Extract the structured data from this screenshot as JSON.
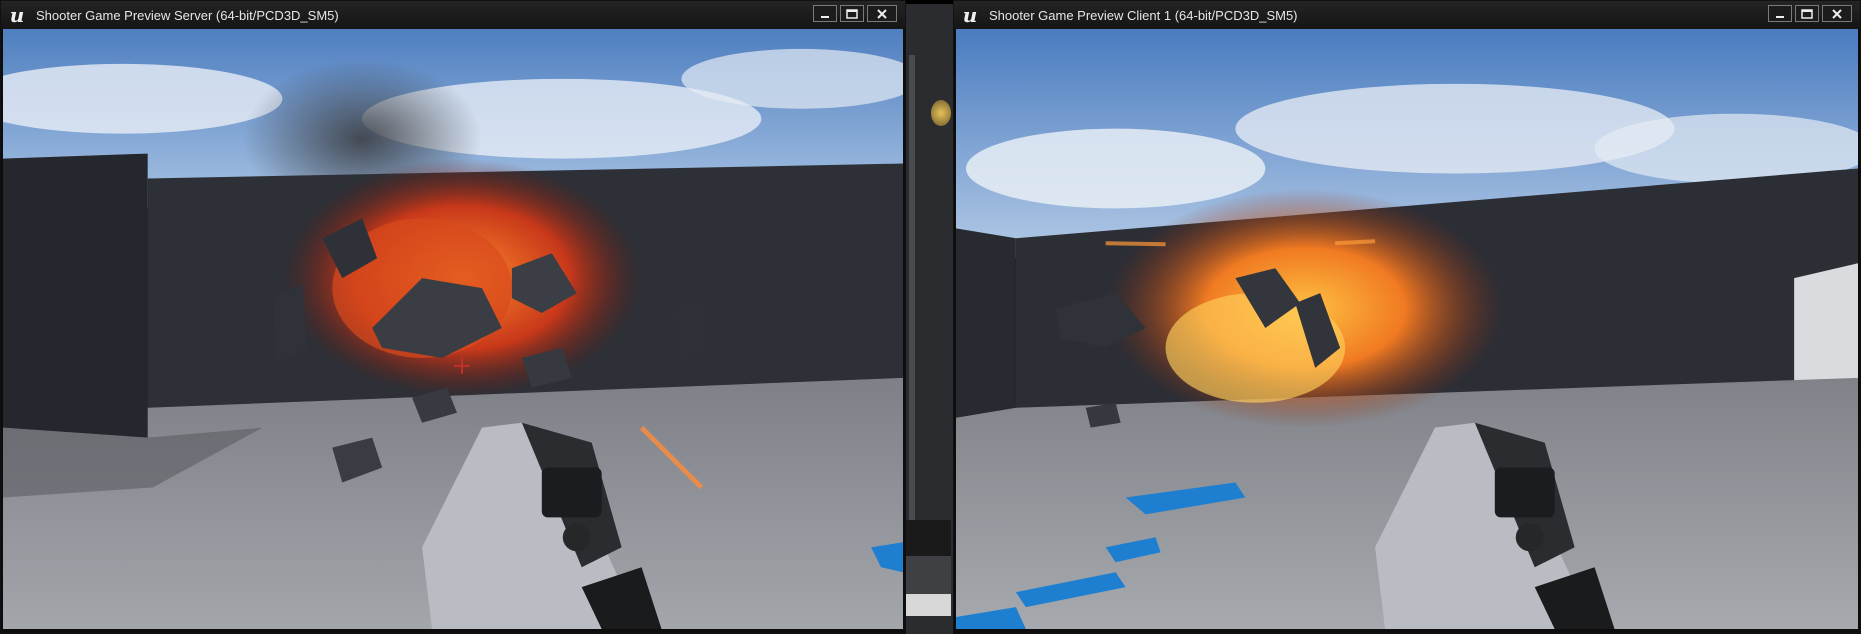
{
  "windows": {
    "server": {
      "title": "Shooter Game Preview Server (64-bit/PCD3D_SM5)",
      "logo": "ue-logo-icon",
      "controls": {
        "minimize": "minimize-icon",
        "maximize": "maximize-icon",
        "close": "close-icon"
      }
    },
    "client": {
      "title": "Shooter Game Preview Client 1 (64-bit/PCD3D_SM5)",
      "logo": "ue-logo-icon",
      "controls": {
        "minimize": "minimize-icon",
        "maximize": "maximize-icon",
        "close": "close-icon"
      }
    }
  },
  "colors": {
    "sky": "#7fa6d6",
    "wall": "#2b2e35",
    "floor": "#8d9096",
    "fire": "#e2521c",
    "fire_core": "#ffb433",
    "floor_marking": "#1e7fd0",
    "titlebar": "#1b1b1b"
  }
}
